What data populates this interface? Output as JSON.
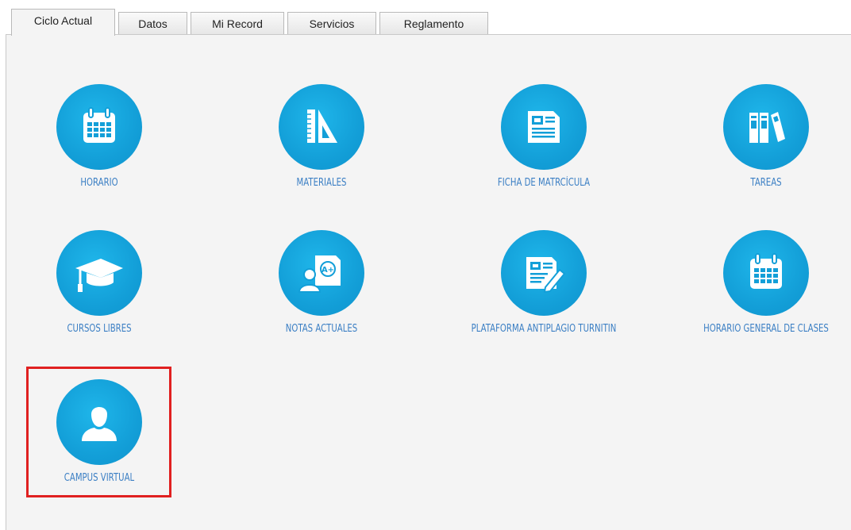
{
  "tabs": [
    {
      "label": "Ciclo Actual",
      "active": true
    },
    {
      "label": "Datos"
    },
    {
      "label": "Mi Record"
    },
    {
      "label": "Servicios"
    },
    {
      "label": "Reglamento"
    }
  ],
  "items": [
    {
      "label": "HORARIO",
      "icon": "calendar-icon"
    },
    {
      "label": "MATERIALES",
      "icon": "ruler-triangle-icon"
    },
    {
      "label": "FICHA DE MATRCÍCULA",
      "icon": "document-card-icon"
    },
    {
      "label": "TAREAS",
      "icon": "books-icon"
    },
    {
      "label": "CURSOS LIBRES",
      "icon": "graduation-cap-icon"
    },
    {
      "label": "NOTAS ACTUALES",
      "icon": "student-grade-icon"
    },
    {
      "label": "PLATAFORMA ANTIPLAGIO TURNITIN",
      "icon": "document-pencil-icon"
    },
    {
      "label": "HORARIO GENERAL DE CLASES",
      "icon": "calendar-icon"
    },
    {
      "label": "CAMPUS VIRTUAL",
      "icon": "user-icon"
    }
  ],
  "colors": {
    "icon_circle": "#139fd8",
    "label": "#3b7fc4",
    "highlight": "#e02020"
  }
}
